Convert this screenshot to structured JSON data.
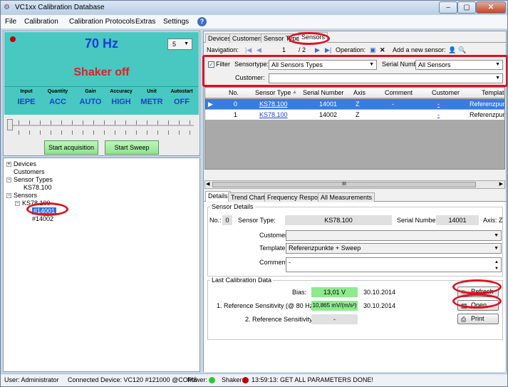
{
  "window": {
    "title": "VC1xx Calibration Database"
  },
  "menu": {
    "file": "File",
    "calibration": "Calibration",
    "protocols": "Calibration Protocols",
    "extras": "Extras",
    "settings": "Settings"
  },
  "shaker": {
    "frequency": "70 Hz",
    "freq_step": "5",
    "state": "Shaker off",
    "params": [
      {
        "head": "Input",
        "value": "IEPE"
      },
      {
        "head": "Quantity",
        "value": "ACC"
      },
      {
        "head": "Gain",
        "value": "AUTO"
      },
      {
        "head": "Accuracy",
        "value": "HIGH"
      },
      {
        "head": "Unit",
        "value": "METR"
      },
      {
        "head": "Autostart",
        "value": "OFF"
      }
    ],
    "start_acq": "Start acquisition",
    "start_sweep": "Start Sweep"
  },
  "tree": {
    "devices": "Devices",
    "customers": "Customers",
    "sensor_types": "Sensor Types",
    "type_item": "KS78.100",
    "sensors": "Sensors",
    "sensor_group": "KS78.100",
    "sensor_1": "#14001",
    "sensor_2": "#14002"
  },
  "tabs": {
    "devices": "Devices",
    "customers": "Customers",
    "sensor_types": "Sensor Types",
    "sensors": "Sensors"
  },
  "nav": {
    "label": "Navigation:",
    "current": "1",
    "total": "/ 2",
    "operation": "Operation:",
    "add_new": "Add a new sensor:"
  },
  "filter": {
    "filter_label": "Filter",
    "sensortype_label": "Sensortype:",
    "sensortype_value": "All Sensors Types",
    "serial_label": "Serial Number:",
    "serial_value": "All Sensors",
    "customer_label": "Customer:",
    "customer_value": ""
  },
  "grid": {
    "columns": {
      "no": "No.",
      "type": "Sensor Type",
      "serial": "Serial Number",
      "axis": "Axis",
      "comment": "Comment",
      "customer": "Customer",
      "template": "Template"
    },
    "rows": [
      {
        "no": "0",
        "type": "KS78.100",
        "serial": "14001",
        "axis": "Z",
        "comment": "-",
        "customer": "-",
        "template": "Referenzpunkte -"
      },
      {
        "no": "1",
        "type": "KS78.100",
        "serial": "14002",
        "axis": "Z",
        "comment": "",
        "customer": "-",
        "template": "Referenzpunkte -"
      }
    ],
    "scroll_grip": "III"
  },
  "detail_tabs": {
    "details": "Details",
    "trend": "Trend Chart",
    "freq": "Frequency Response",
    "all": "All Measurements"
  },
  "details": {
    "group": "Sensor Details",
    "no_label": "No.:",
    "no_value": "0",
    "type_label": "Sensor Type:",
    "type_value": "KS78.100",
    "serial_label": "Serial Number:",
    "serial_value": "14001",
    "axis_label": "Axis:",
    "axis_value": "Z",
    "customer_label": "Customer:",
    "customer_value": "",
    "template_label": "Template:",
    "template_value": "Referenzpunkte + Sweep",
    "comment_label": "Comment:",
    "comment_value": "-"
  },
  "calib": {
    "group": "Last Calibration Data",
    "bias_label": "Bias:",
    "bias_value": "13,01 V",
    "bias_date": "30.10.2014",
    "ref1_label": "1. Reference Sensitivity (@ 80 Hz):",
    "ref1_value": "10,865 mV/(m/s²)",
    "ref1_date": "30.10.2014",
    "ref2_label": "2. Reference Sensitivity:",
    "ref2_value": "-",
    "refresh": "Refresh",
    "open": "Open",
    "print": "Print"
  },
  "status": {
    "user": "User: Administrator",
    "device": "Connected Device: VC120 #121000 @COM8",
    "power": "Power:",
    "shaker": "Shaker:",
    "message": "13:59:13: GET ALL PARAMETERS DONE!"
  },
  "colors": {
    "teal": "#48c8c0",
    "highlight": "#e01020",
    "selection": "#3a7be0",
    "value_blue": "#1a3fd6"
  }
}
